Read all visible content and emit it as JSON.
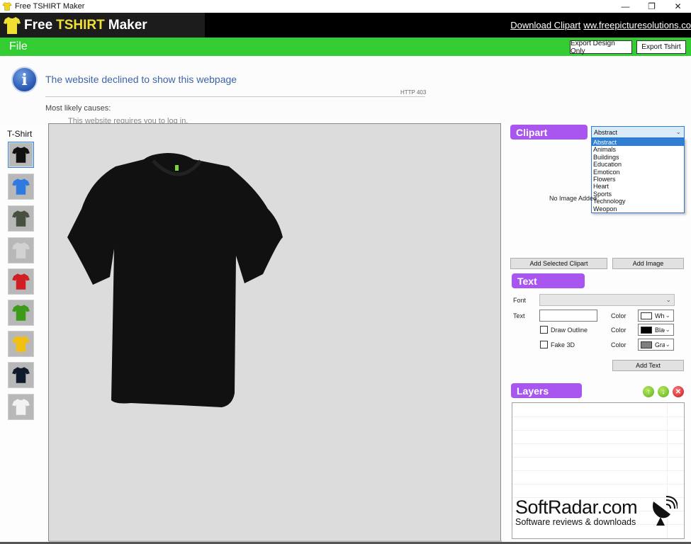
{
  "window": {
    "title": "Free TSHIRT Maker",
    "controls": {
      "minimize": "—",
      "maximize": "❐",
      "close": "✕"
    }
  },
  "banner": {
    "logo_part1": "Free",
    "logo_part2": "TSHIRT",
    "logo_part3": "Maker",
    "link_download": "Download Clipart",
    "link_site": "ww.freepicturesolutions.co"
  },
  "menubar": {
    "file_label": "File",
    "export_design_label": "Export Design Only",
    "export_tshirt_label": "Export Tshirt"
  },
  "error_page": {
    "title": "The website declined to show this webpage",
    "code": "HTTP 403",
    "causes_label": "Most likely causes:",
    "cut_text": "This website requires you to log in."
  },
  "tshirts": {
    "label": "T-Shirt",
    "items": [
      {
        "name": "black",
        "color": "#111111",
        "selected": true
      },
      {
        "name": "blue",
        "color": "#2f7ae0",
        "selected": false
      },
      {
        "name": "dark-gray",
        "color": "#48503f",
        "selected": false
      },
      {
        "name": "light-gray",
        "color": "#d2d2d2",
        "selected": false
      },
      {
        "name": "red",
        "color": "#d01e22",
        "selected": false
      },
      {
        "name": "green",
        "color": "#3f9a1a",
        "selected": false
      },
      {
        "name": "yellow",
        "color": "#f1bf12",
        "selected": false
      },
      {
        "name": "navy",
        "color": "#0f1a2c",
        "selected": false
      },
      {
        "name": "white",
        "color": "#f2f2f2",
        "selected": false
      }
    ]
  },
  "canvas": {
    "shirt_color": "#111111",
    "tag_color": "#7bd43a",
    "background": "#dcdcdc"
  },
  "clipart": {
    "header": "Clipart",
    "selected": "Abstract",
    "options": [
      "Abstract",
      "Animals",
      "Buildings",
      "Education",
      "Emoticon",
      "Flowers",
      "Heart",
      "Sports",
      "Technology",
      "Weopon"
    ],
    "preview_text": "No Image Added",
    "add_selected_label": "Add Selected Clipart",
    "add_image_label": "Add Image"
  },
  "text_panel": {
    "header": "Text",
    "font_label": "Font",
    "font_value": "",
    "text_label": "Text",
    "text_value": "",
    "color_label": "Color",
    "draw_outline_label": "Draw Outline",
    "fake3d_label": "Fake 3D",
    "draw_outline_checked": false,
    "fake3d_checked": false,
    "text_color": {
      "name": "White",
      "swatch": "#ffffff"
    },
    "outline_color": {
      "name": "Black",
      "swatch": "#000000"
    },
    "fake3d_color": {
      "name": "Gray",
      "swatch": "#808080"
    },
    "add_text_label": "Add Text"
  },
  "layers": {
    "header": "Layers",
    "up_icon": "↑",
    "down_icon": "↓",
    "delete_icon": "✕",
    "items": []
  },
  "watermark": {
    "main": "SoftRadar.com",
    "sub": "Software reviews & downloads"
  },
  "colors": {
    "accent_green": "#33cc33",
    "pill_purple": "#a956f0",
    "logo_yellow": "#f0e034",
    "link_blue": "#3c64a8"
  }
}
